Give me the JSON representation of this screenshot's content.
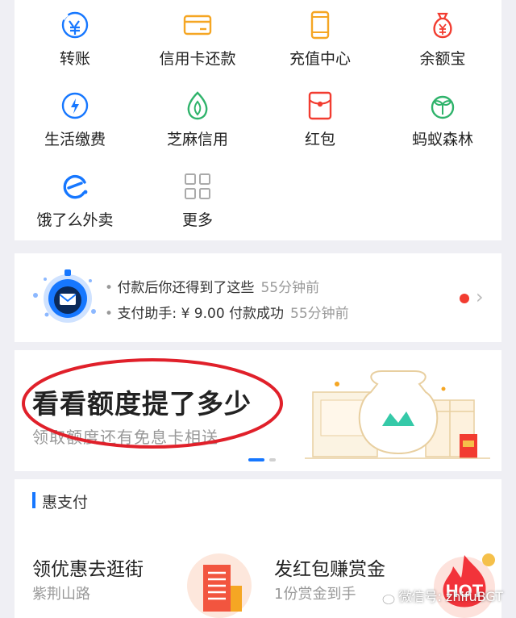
{
  "grid": {
    "items": [
      {
        "label": "转账",
        "icon": "transfer-icon"
      },
      {
        "label": "信用卡还款",
        "icon": "credit-card-icon"
      },
      {
        "label": "充值中心",
        "icon": "phone-recharge-icon"
      },
      {
        "label": "余额宝",
        "icon": "money-bag-icon"
      },
      {
        "label": "生活缴费",
        "icon": "water-drop-icon"
      },
      {
        "label": "芝麻信用",
        "icon": "sesame-credit-icon"
      },
      {
        "label": "红包",
        "icon": "red-envelope-icon"
      },
      {
        "label": "蚂蚁森林",
        "icon": "sprout-icon"
      },
      {
        "label": "饿了么外卖",
        "icon": "eleme-icon"
      },
      {
        "label": "更多",
        "icon": "more-grid-icon"
      }
    ]
  },
  "notice": {
    "line1": "付款后你还得到了这些",
    "time1": "55分钟前",
    "line2": "支付助手: ¥ 9.00 付款成功",
    "time2": "55分钟前"
  },
  "banner": {
    "headline": "看看额度提了多少",
    "sub": "领取额度还有免息卡相送"
  },
  "hui": {
    "section_title": "惠支付",
    "item1_title": "领优惠去逛街",
    "item1_sub": "紫荆山路",
    "item2_title": "发红包赚赏金",
    "item2_sub": "1份赏金到手",
    "hot_badge": "HOT"
  },
  "watermark": "微信号: zhifuBGT",
  "colors": {
    "accent": "#1677ff",
    "red": "#f23c30",
    "orange": "#f5a623",
    "green": "#2fb36b"
  }
}
